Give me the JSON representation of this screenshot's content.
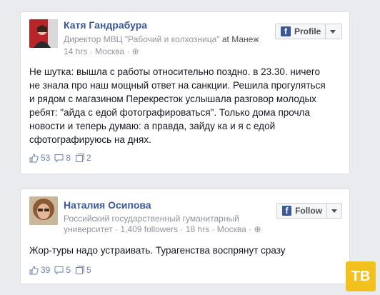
{
  "post1": {
    "author": "Катя Гандрабура",
    "title": "Директор МВЦ \"Рабочий и колхозница\"",
    "at": "at",
    "place": "Манеж",
    "time": "14 hrs",
    "location": "Москва",
    "button_label": "Profile",
    "text_lines": [
      "Не шутка: вышла с работы относительно поздно. в 23.30. ничего",
      "не знала про наш мощный ответ на санкции. Решила прогуляться",
      "и рядом с магазином Перекресток услышала разговор молодых",
      "ребят: \"айда с едой фотографироваться\". Только дома прочла",
      "новости и теперь думаю: а правда, зайду ка и я с едой",
      "сфотографируюсь на днях."
    ],
    "likes": "53",
    "comments": "8",
    "shares": "2"
  },
  "post2": {
    "author": "Наталия Осипова",
    "meta_line1": "Российский государственный гуманитарный",
    "meta_line2_a": "университет · 1,409 followers · 18 hrs · Москва ·",
    "button_label": "Follow",
    "text": "Жор-туры надо устраивать. Турагенства воспрянут сразу",
    "likes": "39",
    "comments": "5",
    "shares": "5"
  },
  "watermark": "TB",
  "colors": {
    "link": "#3b5998",
    "meta": "#90949c",
    "background": "#e9ebee"
  }
}
